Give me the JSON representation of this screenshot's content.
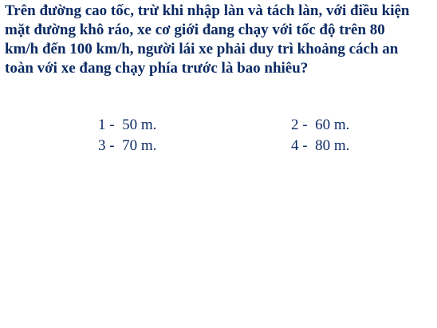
{
  "question": {
    "lines": [
      "Trên đường cao tốc, trừ khi nhập làn và tách làn, với điều kiện",
      "mặt đường khô ráo, xe cơ giới đang chạy với tốc độ trên 80",
      "km/h đến 100 km/h, người lái xe phải duy trì khoảng cách an",
      "toàn với xe đang chạy phía trước là bao nhiêu?"
    ]
  },
  "answers": [
    {
      "number": "1",
      "text": "50 m."
    },
    {
      "number": "2",
      "text": "60 m."
    },
    {
      "number": "3",
      "text": "70 m."
    },
    {
      "number": "4",
      "text": "80 m."
    }
  ],
  "separator": " -  ",
  "colors": {
    "text": "#0b2a63",
    "background": "#ffffff"
  }
}
